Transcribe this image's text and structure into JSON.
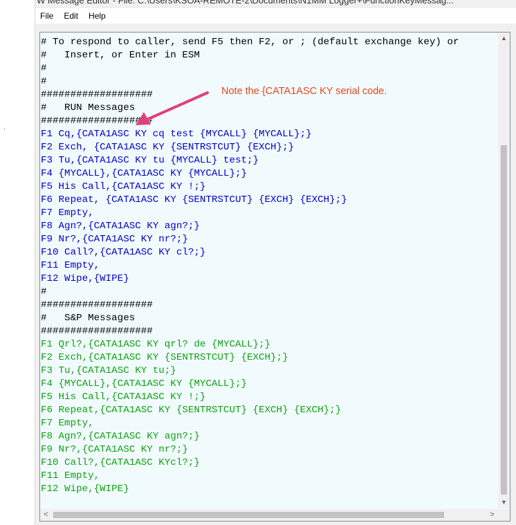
{
  "window": {
    "title": "W Message Editor - File: C:\\Users\\KSOA-REMOTE-2\\Documents\\N1MM Logger+\\FunctionKeyMessag..."
  },
  "menu": {
    "file": "File",
    "edit": "Edit",
    "help": "Help"
  },
  "editor": {
    "lines": [
      {
        "text": "# To respond to caller, send F5 then F2, or ; (default exchange key) or",
        "color": "black"
      },
      {
        "text": "#   Insert, or Enter in ESM",
        "color": "black"
      },
      {
        "text": "#",
        "color": "black"
      },
      {
        "text": "#",
        "color": "black"
      },
      {
        "text": "###################",
        "color": "black"
      },
      {
        "text": "#   RUN Messages",
        "color": "black"
      },
      {
        "text": "###################",
        "color": "black"
      },
      {
        "text": "F1 Cq,{CATA1ASC KY cq test {MYCALL} {MYCALL};}",
        "color": "blue"
      },
      {
        "text": "F2 Exch, {CATA1ASC KY {SENTRSTCUT} {EXCH};}",
        "color": "blue"
      },
      {
        "text": "F3 Tu,{CATA1ASC KY tu {MYCALL} test;}",
        "color": "blue"
      },
      {
        "text": "F4 {MYCALL},{CATA1ASC KY {MYCALL};}",
        "color": "blue"
      },
      {
        "text": "F5 His Call,{CATA1ASC KY !;}",
        "color": "blue"
      },
      {
        "text": "F6 Repeat, {CATA1ASC KY {SENTRSTCUT} {EXCH} {EXCH};}",
        "color": "blue"
      },
      {
        "text": "F7 Empty,",
        "color": "blue"
      },
      {
        "text": "F8 Agn?,{CATA1ASC KY agn?;}",
        "color": "blue"
      },
      {
        "text": "F9 Nr?,{CATA1ASC KY nr?;}",
        "color": "blue"
      },
      {
        "text": "F10 Call?,{CATA1ASC KY cl?;}",
        "color": "blue"
      },
      {
        "text": "F11 Empty,",
        "color": "blue"
      },
      {
        "text": "F12 Wipe,{WIPE}",
        "color": "blue"
      },
      {
        "text": "#",
        "color": "black"
      },
      {
        "text": "###################",
        "color": "black"
      },
      {
        "text": "#   S&P Messages",
        "color": "black"
      },
      {
        "text": "###################",
        "color": "black"
      },
      {
        "text": "F1 Qrl?,{CATA1ASC KY qrl? de {MYCALL};}",
        "color": "green"
      },
      {
        "text": "F2 Exch,{CATA1ASC KY {SENTRSTCUT} {EXCH};}",
        "color": "green"
      },
      {
        "text": "F3 Tu,{CATA1ASC KY tu;}",
        "color": "green"
      },
      {
        "text": "F4 {MYCALL},{CATA1ASC KY {MYCALL};}",
        "color": "green"
      },
      {
        "text": "F5 His Call,{CATA1ASC KY !;}",
        "color": "green"
      },
      {
        "text": "F6 Repeat,{CATA1ASC KY {SENTRSTCUT} {EXCH} {EXCH};}",
        "color": "green"
      },
      {
        "text": "F7 Empty,",
        "color": "green"
      },
      {
        "text": "F8 Agn?,{CATA1ASC KY agn?;}",
        "color": "green"
      },
      {
        "text": "F9 Nr?,{CATA1ASC KY nr?;}",
        "color": "green"
      },
      {
        "text": "F10 Call?,{CATA1ASC KYcl?;}",
        "color": "green"
      },
      {
        "text": "F11 Empty,",
        "color": "green"
      },
      {
        "text": "F12 Wipe,{WIPE}",
        "color": "green"
      }
    ]
  },
  "annotation": {
    "text": "Note the {CATA1ASC KY serial code.",
    "color": "#e8461c",
    "arrow_color": "#e0407a"
  },
  "colors": {
    "black": "#000000",
    "blue": "#0000c8",
    "green": "#10a010",
    "editor_bg": "#f1fbfe"
  },
  "icons": {
    "scroll_up": "▲",
    "scroll_down": "▼",
    "scroll_left": "<",
    "scroll_right": ">"
  }
}
